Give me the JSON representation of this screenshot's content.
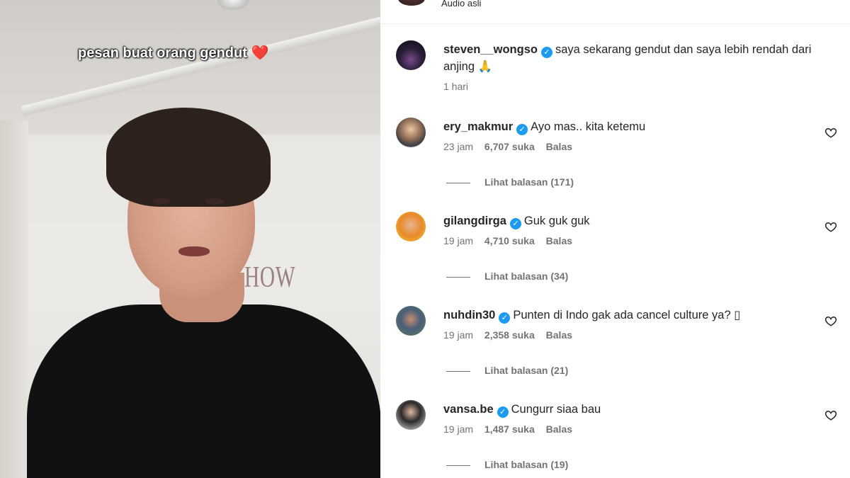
{
  "video": {
    "caption": "pesan buat orang gendut",
    "caption_emoji": "❤️",
    "wall_text": "HOW"
  },
  "top": {
    "audio_label": "Audio asli"
  },
  "post": {
    "username": "steven__wongso",
    "verified": true,
    "text": "saya sekarang gendut dan saya lebih rendah dari anjing 🙏",
    "time": "1 hari"
  },
  "comments": [
    {
      "username": "ery_makmur",
      "verified": true,
      "text": "Ayo mas.. kita ketemu",
      "time": "23 jam",
      "likes": "6,707 suka",
      "reply": "Balas",
      "view_replies": "Lihat balasan (171)"
    },
    {
      "username": "gilangdirga",
      "verified": true,
      "text": "Guk guk guk",
      "time": "19 jam",
      "likes": "4,710 suka",
      "reply": "Balas",
      "view_replies": "Lihat balasan (34)"
    },
    {
      "username": "nuhdin30",
      "verified": true,
      "text": "Punten di Indo gak ada cancel culture ya? ▯",
      "time": "19 jam",
      "likes": "2,358 suka",
      "reply": "Balas",
      "view_replies": "Lihat balasan (21)"
    },
    {
      "username": "vansa.be",
      "verified": true,
      "text": "Cungurr siaa bau",
      "time": "19 jam",
      "likes": "1,487 suka",
      "reply": "Balas",
      "view_replies": "Lihat balasan (19)"
    }
  ],
  "icons": {
    "verified": "verified-badge-icon",
    "like": "heart-outline-icon"
  },
  "colors": {
    "verified": "#1d9bf0",
    "meta_text": "#737373",
    "caption_heart": "#e0182d"
  }
}
